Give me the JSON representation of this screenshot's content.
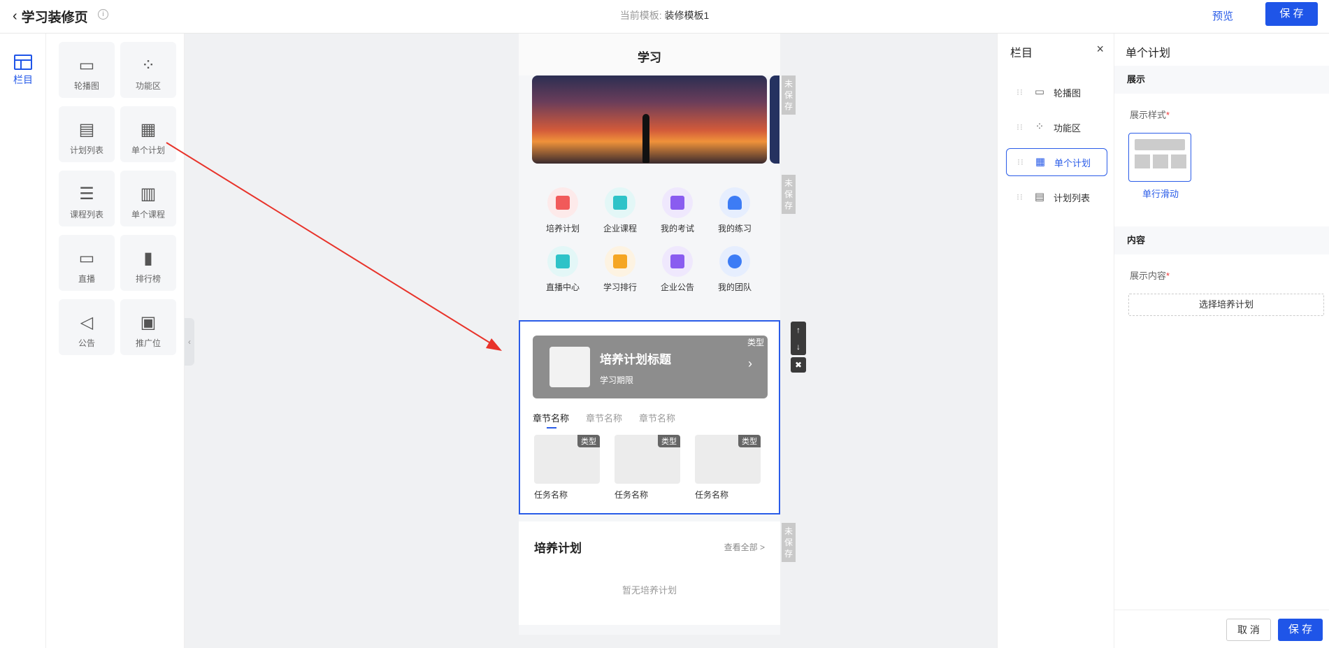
{
  "header": {
    "back_label": "学习装修页",
    "template_prefix": "当前模板:",
    "template_name": "装修模板1",
    "preview_label": "预览",
    "save_label": "保 存"
  },
  "rail": {
    "label": "栏目"
  },
  "components": [
    {
      "label": "轮播图",
      "icon": "image-icon"
    },
    {
      "label": "功能区",
      "icon": "grid-icon"
    },
    {
      "label": "计划列表",
      "icon": "calendar-stack-icon"
    },
    {
      "label": "单个计划",
      "icon": "calendar-icon"
    },
    {
      "label": "课程列表",
      "icon": "layers-icon"
    },
    {
      "label": "单个课程",
      "icon": "book-icon"
    },
    {
      "label": "直播",
      "icon": "video-icon"
    },
    {
      "label": "排行榜",
      "icon": "bar-chart-icon"
    },
    {
      "label": "公告",
      "icon": "megaphone-icon"
    },
    {
      "label": "推广位",
      "icon": "picture-icon"
    }
  ],
  "phone": {
    "title": "学习",
    "unsaved_label": "未保存",
    "functions": [
      {
        "label": "培养计划",
        "color": "#f15a5a"
      },
      {
        "label": "企业课程",
        "color": "#2ec3c8"
      },
      {
        "label": "我的考试",
        "color": "#8a5cf0"
      },
      {
        "label": "我的练习",
        "color": "#3d7cf5"
      },
      {
        "label": "直播中心",
        "color": "#2ec3c8"
      },
      {
        "label": "学习排行",
        "color": "#f5a623"
      },
      {
        "label": "企业公告",
        "color": "#8a5cf0"
      },
      {
        "label": "我的团队",
        "color": "#3d7cf5"
      }
    ],
    "single_plan": {
      "title": "培养计划标题",
      "subtitle": "学习期限",
      "type_label": "类型",
      "chapters": [
        "章节名称",
        "章节名称",
        "章节名称"
      ],
      "tasks": [
        "任务名称",
        "任务名称",
        "任务名称"
      ]
    },
    "plan_list": {
      "title": "培养计划",
      "more": "查看全部 >",
      "empty": "暂无培养计划"
    }
  },
  "outline": {
    "title": "栏目",
    "items": [
      {
        "label": "轮播图"
      },
      {
        "label": "功能区"
      },
      {
        "label": "单个计划"
      },
      {
        "label": "计划列表"
      }
    ]
  },
  "settings": {
    "title": "单个计划",
    "display_section": "展示",
    "style_label": "展示样式",
    "style_option": "单行滑动",
    "content_section": "内容",
    "content_label": "展示内容",
    "choose_button": "选择培养计划",
    "cancel_label": "取 消",
    "save_label": "保 存"
  },
  "colors": {
    "accent": "#1f55e8",
    "arrow": "#e8332a"
  }
}
